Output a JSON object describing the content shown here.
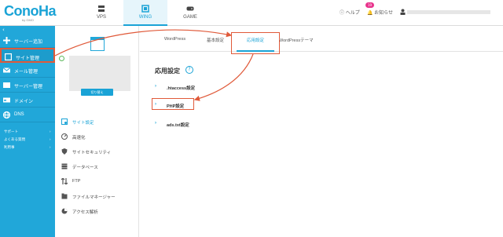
{
  "header": {
    "logo": "ConoHa",
    "logo_sub": "by GMO",
    "nav": [
      {
        "label": "VPS",
        "icon": "server-icon"
      },
      {
        "label": "WING",
        "icon": "wing-icon"
      },
      {
        "label": "GAME",
        "icon": "gamepad-icon"
      }
    ],
    "help_label": "ヘルプ",
    "notice_label": "お知らせ",
    "notice_count": "19"
  },
  "sidebar": {
    "back": "‹",
    "items": [
      {
        "label": "サーバー追加",
        "icon": "plus-icon"
      },
      {
        "label": "サイト管理",
        "icon": "site-icon"
      },
      {
        "label": "メール管理",
        "icon": "mail-icon"
      },
      {
        "label": "サーバー管理",
        "icon": "server-manage-icon"
      },
      {
        "label": "ドメイン",
        "icon": "domain-icon"
      },
      {
        "label": "DNS",
        "icon": "globe-icon"
      }
    ],
    "small_items": [
      {
        "label": "サポート"
      },
      {
        "label": "よくある質問"
      },
      {
        "label": "利用事"
      }
    ]
  },
  "site_panel": {
    "switch_button": "切り替え",
    "menu": [
      {
        "label": "サイト設定",
        "icon": "site-settings-icon"
      },
      {
        "label": "高速化",
        "icon": "speed-icon"
      },
      {
        "label": "サイトセキュリティ",
        "icon": "shield-icon"
      },
      {
        "label": "データベース",
        "icon": "database-icon"
      },
      {
        "label": "FTP",
        "icon": "ftp-icon"
      },
      {
        "label": "ファイルマネージャー",
        "icon": "folder-icon"
      },
      {
        "label": "アクセス解析",
        "icon": "chart-icon"
      }
    ]
  },
  "main": {
    "tabs": [
      {
        "label": "WordPress"
      },
      {
        "label": "基本設定"
      },
      {
        "label": "応用設定"
      },
      {
        "label": "WordPressテーマ"
      }
    ],
    "section_title": "応用設定",
    "help_mark": "?",
    "settings": [
      {
        "label": ".htaccess設定"
      },
      {
        "label": "PHP設定"
      },
      {
        "label": "ads.txt設定"
      }
    ]
  },
  "colors": {
    "accent": "#1aa3d6",
    "sidebar": "#21a7d9",
    "highlight": "#e05a3a",
    "badge": "#e8338c"
  }
}
